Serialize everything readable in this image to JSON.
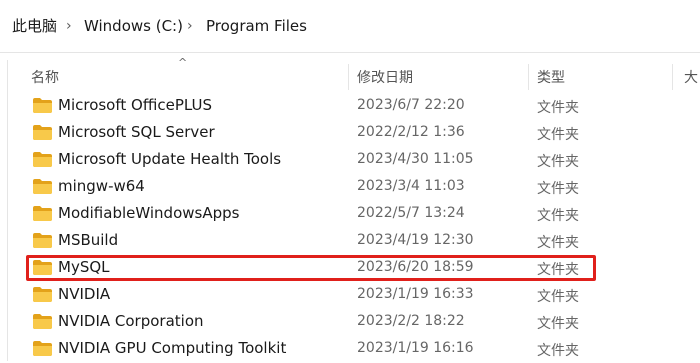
{
  "breadcrumb": {
    "items": [
      "此电脑",
      "Windows (C:)",
      "Program Files"
    ]
  },
  "columns": {
    "name": "名称",
    "date": "修改日期",
    "type": "类型",
    "size": "大"
  },
  "files": [
    {
      "name": "Microsoft OfficePLUS",
      "date": "2023/6/7 22:20",
      "type": "文件夹"
    },
    {
      "name": "Microsoft SQL Server",
      "date": "2022/2/12 1:36",
      "type": "文件夹"
    },
    {
      "name": "Microsoft Update Health Tools",
      "date": "2023/4/30 11:05",
      "type": "文件夹"
    },
    {
      "name": "mingw-w64",
      "date": "2023/3/4 11:03",
      "type": "文件夹"
    },
    {
      "name": "ModifiableWindowsApps",
      "date": "2022/5/7 13:24",
      "type": "文件夹"
    },
    {
      "name": "MSBuild",
      "date": "2023/4/19 12:30",
      "type": "文件夹"
    },
    {
      "name": "MySQL",
      "date": "2023/6/20 18:59",
      "type": "文件夹"
    },
    {
      "name": "NVIDIA",
      "date": "2023/1/19 16:33",
      "type": "文件夹"
    },
    {
      "name": "NVIDIA Corporation",
      "date": "2023/2/2 18:22",
      "type": "文件夹"
    },
    {
      "name": "NVIDIA GPU Computing Toolkit",
      "date": "2023/1/19 16:16",
      "type": "文件夹"
    }
  ],
  "icons": {
    "folder": "folder-icon",
    "chevron": "chevron-right-icon",
    "sort": "sort-ascending-icon"
  },
  "colors": {
    "folder_fill": "#F8C94A",
    "folder_dark": "#E3A21A",
    "highlight": "#E0201B"
  }
}
